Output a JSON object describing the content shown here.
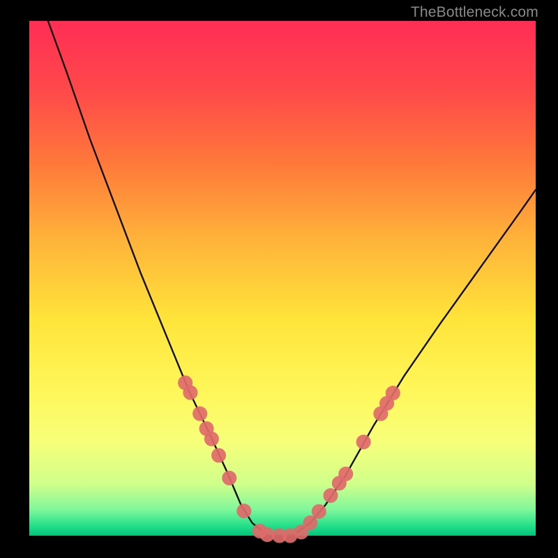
{
  "watermark": "TheBottleneck.com",
  "chart_data": {
    "type": "line",
    "title": "",
    "xlabel": "",
    "ylabel": "",
    "xlim": [
      0,
      1
    ],
    "ylim": [
      0,
      1
    ],
    "background_gradient_top": "#ff2d55",
    "background_gradient_bottom": "#00c47a",
    "series": [
      {
        "name": "bottleneck-curve",
        "x": [
          0.037,
          0.074,
          0.12,
          0.17,
          0.22,
          0.27,
          0.315,
          0.355,
          0.39,
          0.418,
          0.44,
          0.47,
          0.49,
          0.52,
          0.555,
          0.585,
          0.625,
          0.68,
          0.74,
          0.81,
          0.89,
          0.97,
          1.0
        ],
        "y": [
          1.0,
          0.9,
          0.77,
          0.64,
          0.51,
          0.39,
          0.282,
          0.2,
          0.125,
          0.06,
          0.025,
          0.0,
          0.0,
          0.0,
          0.025,
          0.06,
          0.118,
          0.214,
          0.31,
          0.41,
          0.52,
          0.63,
          0.672
        ]
      }
    ],
    "markers": {
      "name": "data-beads",
      "color": "#e06a6a",
      "radius_rel": 0.0145,
      "points": [
        {
          "x": 0.308,
          "y": 0.297
        },
        {
          "x": 0.318,
          "y": 0.278
        },
        {
          "x": 0.337,
          "y": 0.237
        },
        {
          "x": 0.35,
          "y": 0.208
        },
        {
          "x": 0.36,
          "y": 0.188
        },
        {
          "x": 0.374,
          "y": 0.156
        },
        {
          "x": 0.395,
          "y": 0.112
        },
        {
          "x": 0.424,
          "y": 0.048
        },
        {
          "x": 0.455,
          "y": 0.009
        },
        {
          "x": 0.47,
          "y": 0.002
        },
        {
          "x": 0.494,
          "y": 0.0
        },
        {
          "x": 0.515,
          "y": 0.0
        },
        {
          "x": 0.537,
          "y": 0.007
        },
        {
          "x": 0.555,
          "y": 0.025
        },
        {
          "x": 0.572,
          "y": 0.047
        },
        {
          "x": 0.595,
          "y": 0.078
        },
        {
          "x": 0.612,
          "y": 0.102
        },
        {
          "x": 0.625,
          "y": 0.12
        },
        {
          "x": 0.66,
          "y": 0.182
        },
        {
          "x": 0.694,
          "y": 0.237
        },
        {
          "x": 0.706,
          "y": 0.257
        },
        {
          "x": 0.718,
          "y": 0.277
        }
      ]
    }
  }
}
